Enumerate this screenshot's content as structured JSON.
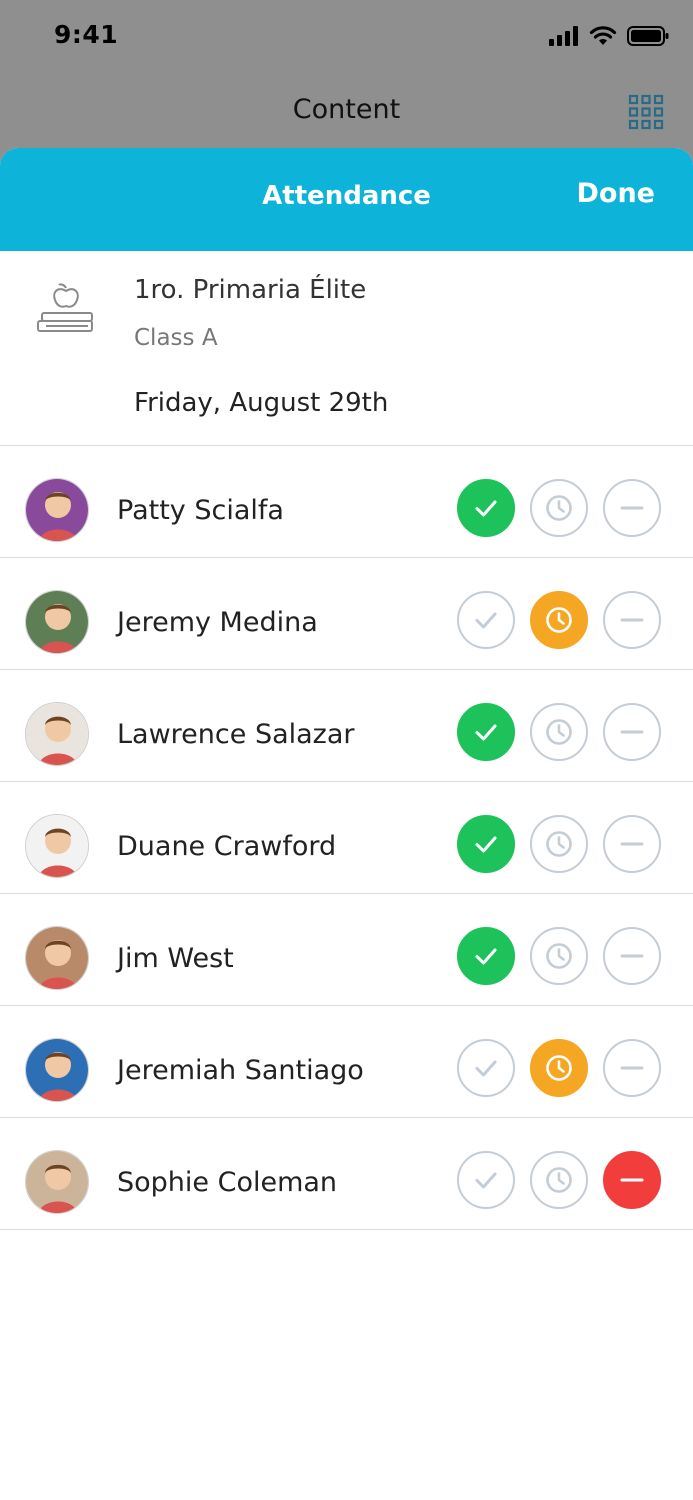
{
  "status_bar": {
    "time": "9:41"
  },
  "background_app": {
    "title": "Content"
  },
  "sheet": {
    "title": "Attendance",
    "done_label": "Done"
  },
  "class_info": {
    "name": "1ro. Primaria Élite",
    "section": "Class A",
    "date": "Friday, August 29th"
  },
  "colors": {
    "header": "#0db3d9",
    "present": "#1dc35a",
    "late": "#f5a623",
    "absent": "#f23d3d",
    "inactive_outline": "#c4ccd6"
  },
  "students": [
    {
      "name": "Patty Scialfa",
      "status": "present",
      "avatar_color": "#8a4a9c"
    },
    {
      "name": "Jeremy Medina",
      "status": "late",
      "avatar_color": "#5e7f56"
    },
    {
      "name": "Lawrence Salazar",
      "status": "present",
      "avatar_color": "#e9e4de"
    },
    {
      "name": "Duane Crawford",
      "status": "present",
      "avatar_color": "#f2f2f2"
    },
    {
      "name": "Jim West",
      "status": "present",
      "avatar_color": "#b98a6a"
    },
    {
      "name": "Jeremiah Santiago",
      "status": "late",
      "avatar_color": "#2d6fb4"
    },
    {
      "name": "Sophie Coleman",
      "status": "absent",
      "avatar_color": "#cbb49a"
    }
  ]
}
